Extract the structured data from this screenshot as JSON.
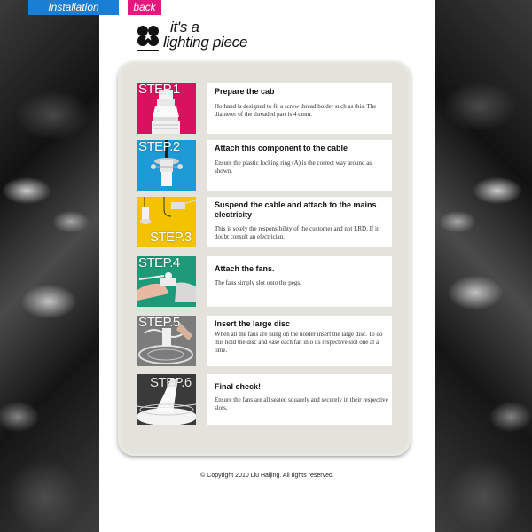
{
  "nav": {
    "installation_label": "Installation",
    "back_label": "back",
    "installation_color": "#1a7fd4",
    "back_color": "#e8177d"
  },
  "brand": {
    "tagline_line1": "it's a",
    "tagline_line2": "lighting piece"
  },
  "steps": [
    {
      "label": "STEP.1",
      "color": "#d8125e",
      "title": "Prepare the cab",
      "description": "Hothand is designed to fit a screw thread holder such as this. The diameter of the threaded part is 4 cmm."
    },
    {
      "label": "STEP.2",
      "color": "#1e9bd7",
      "title": "Attach this component to the cable",
      "description": "Ensure the plastic locking ring (A) is the correct way around as shown."
    },
    {
      "label": "STEP.3",
      "color": "#f3c300",
      "title": "Suspend the cable and attach to the mains electricity",
      "description": "This is solely the responsibility of the customer and not LRD. If in doubt consult an electrician."
    },
    {
      "label": "STEP.4",
      "color": "#1e9a78",
      "title": "Attach the fans.",
      "description": "The fans simply slot onto the pegs."
    },
    {
      "label": "STEP.5",
      "color": "#7c7c7c",
      "title": "Insert the large disc",
      "description": "When all the fans are hung on the holder insert the large disc. To do this hold the disc and ease each fan into its respective slot one at a time."
    },
    {
      "label": "STEP.6",
      "color": "#3a3a3a",
      "title": "Final check!",
      "description": "Ensure the fans are all seated squarely and securely in their respective slots."
    }
  ],
  "footer": {
    "copyright": "© Copyright 2010 Liu Haijing. All rights reserved."
  }
}
